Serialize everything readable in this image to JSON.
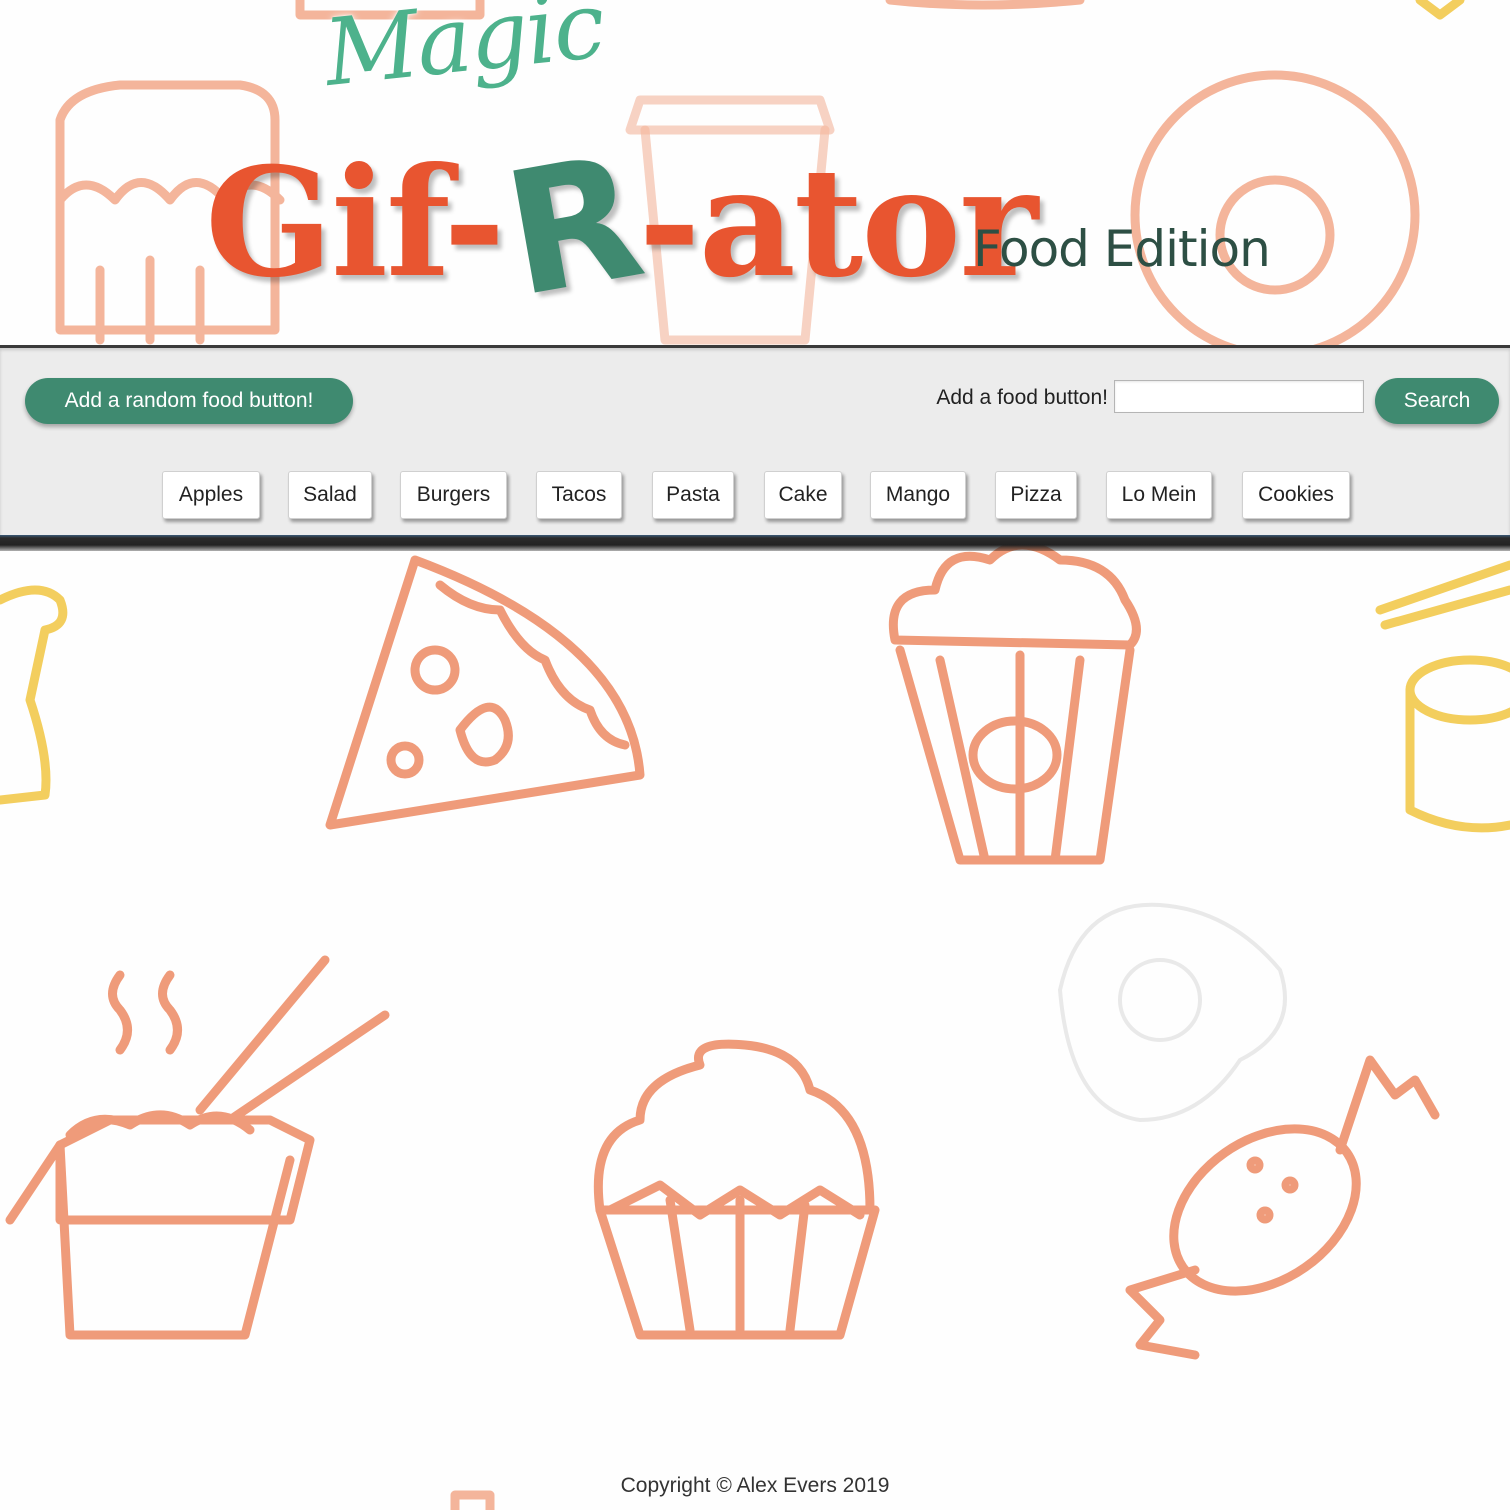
{
  "header": {
    "magic": "Magic",
    "logo_gif": "Gif-",
    "logo_r": "R",
    "logo_ator": "-ator",
    "edition": "Food Edition"
  },
  "toolbar": {
    "random_button": "Add a random food button!",
    "add_label": "Add a food button!",
    "input_value": "",
    "search_button": "Search"
  },
  "food_buttons": [
    "Apples",
    "Salad",
    "Burgers",
    "Tacos",
    "Pasta",
    "Cake",
    "Mango",
    "Pizza",
    "Lo Mein",
    "Cookies"
  ],
  "footer": {
    "copyright": "Copyright © Alex Evers 2019"
  },
  "colors": {
    "accent_green": "#3f8a70",
    "logo_orange": "#e85530",
    "magic_green": "#4db28c",
    "pattern_orange": "#ec8a62",
    "pattern_yellow": "#f2c94c"
  }
}
